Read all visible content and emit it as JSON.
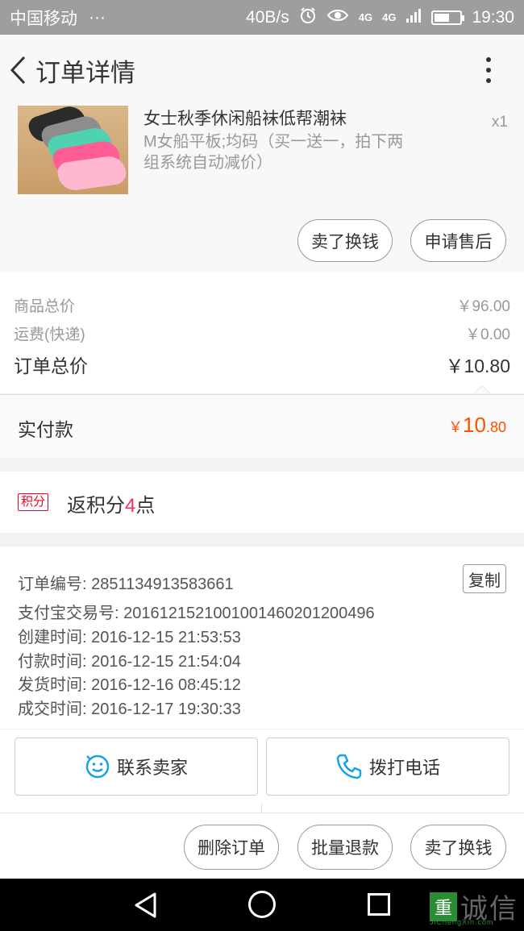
{
  "status_bar": {
    "carrier": "中国移动",
    "dots": "···",
    "speed": "40B/s",
    "network_1": "4G",
    "network_2": "4G",
    "battery_level": 0.6,
    "time": "19:30"
  },
  "header": {
    "title": "订单详情"
  },
  "product": {
    "name": "女士秋季休闲船袜低帮潮袜",
    "spec": "M女船平板;均码（买一送一，拍下两组系统自动减价）",
    "quantity": "x1",
    "sell_button": "卖了换钱",
    "after_sales_button": "申请售后"
  },
  "pricing": {
    "goods_total_label": "商品总价",
    "goods_total_value": "￥96.00",
    "shipping_label": "运费(快递)",
    "shipping_value": "￥0.00",
    "order_total_label": "订单总价",
    "order_total_value": "￥10.80"
  },
  "payment": {
    "label": "实付款",
    "currency": "￥",
    "amount_integer": "10",
    "amount_decimal": ".80"
  },
  "points": {
    "tag": "积分",
    "prefix": "返积分",
    "count": "4",
    "suffix": "点"
  },
  "order_info": {
    "copy_button": "复制",
    "rows": [
      {
        "label": "订单编号:",
        "value": "2851134913583661"
      },
      {
        "label": "支付宝交易号:",
        "value": "2016121521001001460201200496"
      },
      {
        "label": "创建时间:",
        "value": "2016-12-15 21:53:53"
      },
      {
        "label": "付款时间:",
        "value": "2016-12-15 21:54:04"
      },
      {
        "label": "发货时间:",
        "value": "2016-12-16 08:45:12"
      },
      {
        "label": "成交时间:",
        "value": "2016-12-17 19:30:33"
      }
    ]
  },
  "contact": {
    "seller_button": "联系卖家",
    "call_button": "拨打电话"
  },
  "actions": {
    "delete_button": "删除订单",
    "batch_refund_button": "批量退款",
    "sell_button": "卖了换钱"
  },
  "watermark": {
    "logo_char": "重",
    "text": "诚信",
    "sub": "JiChengXin.com"
  },
  "colors": {
    "accent": "#ff5000",
    "points_red": "#ff2a55",
    "icon_blue": "#1aa1e6"
  }
}
